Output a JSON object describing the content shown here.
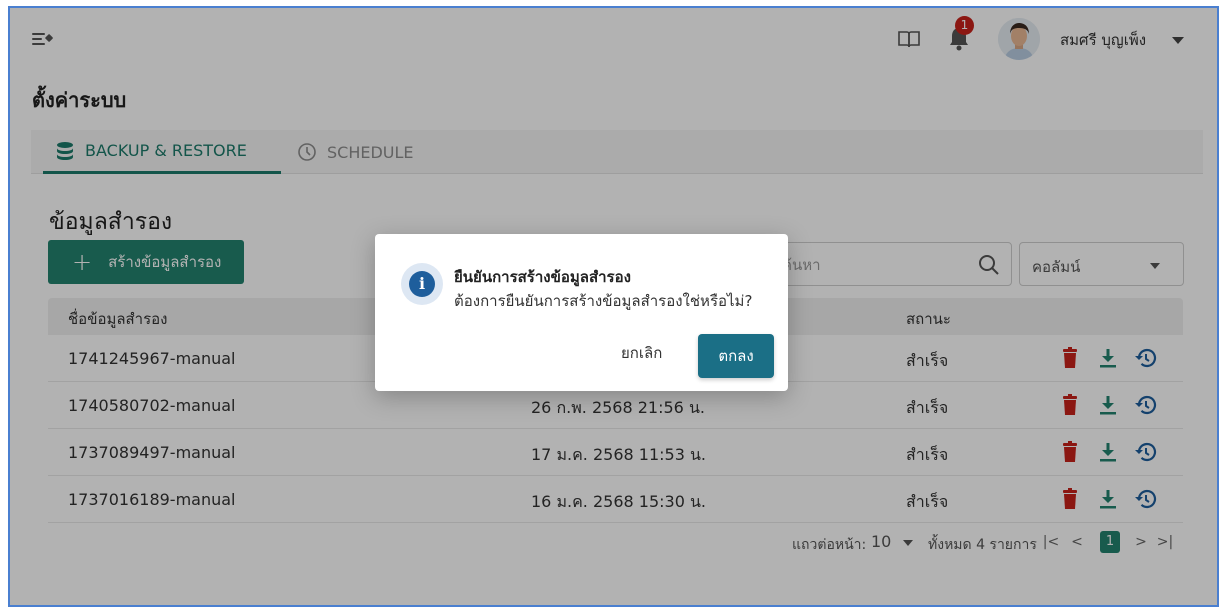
{
  "header": {
    "user_name": "สมศรี บุญเพ็ง",
    "notification_count": "1"
  },
  "page": {
    "title": "ตั้งค่าระบบ"
  },
  "tabs": [
    {
      "label": "BACKUP & RESTORE",
      "active": true
    },
    {
      "label": "SCHEDULE",
      "active": false
    }
  ],
  "section": {
    "title": "ข้อมูลสำรอง",
    "create_button": "สร้างข้อมูลสำรอง",
    "search_placeholder": "ค้นหา",
    "column_select": "คอลัมน์"
  },
  "table": {
    "columns": [
      "ชื่อข้อมูลสำรอง",
      "สถานะ"
    ],
    "rows": [
      {
        "name": "1741245967-manual",
        "date": "",
        "status": "สำเร็จ"
      },
      {
        "name": "1740580702-manual",
        "date": "26 ก.พ. 2568 21:56 น.",
        "status": "สำเร็จ"
      },
      {
        "name": "1737089497-manual",
        "date": "17 ม.ค. 2568 11:53 น.",
        "status": "สำเร็จ"
      },
      {
        "name": "1737016189-manual",
        "date": "16 ม.ค. 2568 15:30 น.",
        "status": "สำเร็จ"
      }
    ]
  },
  "pagination": {
    "rows_label": "แถวต่อหน้า:",
    "rows_per_page": "10",
    "total": "ทั้งหมด 4 รายการ",
    "first": "|<",
    "prev": "<",
    "current": "1",
    "next": ">",
    "last": ">|"
  },
  "dialog": {
    "title": "ยืนยันการสร้างข้อมูลสำรอง",
    "message": "ต้องการยืนยันการสร้างข้อมูลสำรองใช่หรือไม่?",
    "cancel": "ยกเลิก",
    "ok": "ตกลง"
  },
  "colors": {
    "primary": "#23836f",
    "delete": "#c8211a",
    "download": "#23836f",
    "restore": "#1e5e9c",
    "dialog_ok": "#1b6f86"
  }
}
